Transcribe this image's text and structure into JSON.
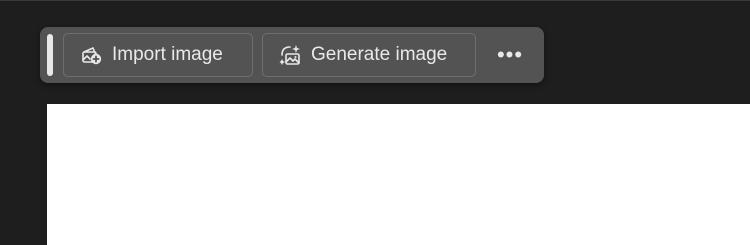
{
  "taskbar": {
    "import_button": {
      "label": "Import image",
      "icon": "import-image-icon"
    },
    "generate_button": {
      "label": "Generate image",
      "icon": "generate-image-icon"
    },
    "more_button": {
      "label": "•••",
      "icon": "more-options-icon"
    }
  },
  "colors": {
    "app_background": "#1e1e1e",
    "taskbar_background": "#535353",
    "canvas": "#ffffff",
    "text": "#e9e9e9"
  }
}
